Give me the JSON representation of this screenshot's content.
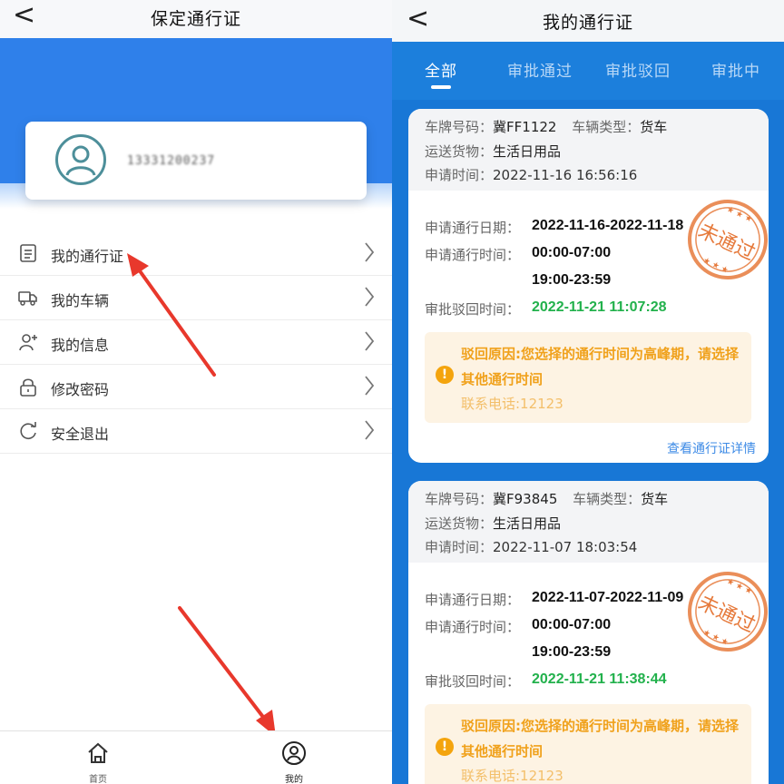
{
  "left": {
    "title": "保定通行证",
    "back_glyph": "<",
    "phone_masked": "13331200237",
    "menu": [
      {
        "label": "我的通行证",
        "icon": "document-list-icon"
      },
      {
        "label": "我的车辆",
        "icon": "truck-icon"
      },
      {
        "label": "我的信息",
        "icon": "user-plus-icon"
      },
      {
        "label": "修改密码",
        "icon": "lock-icon"
      },
      {
        "label": "安全退出",
        "icon": "refresh-icon"
      }
    ],
    "tabbar": [
      {
        "label": "首页",
        "icon": "home-icon"
      },
      {
        "label": "我的",
        "icon": "user-circle-icon"
      }
    ]
  },
  "right": {
    "title": "我的通行证",
    "back_glyph": "<",
    "tabs": [
      {
        "label": "全部",
        "active": true
      },
      {
        "label": "审批通过",
        "active": false
      },
      {
        "label": "审批驳回",
        "active": false
      },
      {
        "label": "审批中",
        "active": false
      }
    ],
    "labels": {
      "plate": "车牌号码：",
      "vehicle_type": "车辆类型：",
      "cargo": "运送货物：",
      "apply_time": "申请时间：",
      "pass_date": "申请通行日期：",
      "pass_time": "申请通行时间：",
      "reject_time": "审批驳回时间：",
      "view_detail": "查看通行证详情",
      "stamp_text": "未通过"
    },
    "cards": [
      {
        "plate": "冀FF1122",
        "vehicle_type": "货车",
        "cargo": "生活日用品",
        "apply_time": "2022-11-16 16:56:16",
        "pass_date": "2022-11-16-2022-11-18",
        "pass_time_1": "00:00-07:00",
        "pass_time_2": "19:00-23:59",
        "reject_time": "2022-11-21 11:07:28",
        "reason": "驳回原因:您选择的通行时间为高峰期，请选择其他通行时间",
        "contact": "联系电话:12123"
      },
      {
        "plate": "冀F93845",
        "vehicle_type": "货车",
        "cargo": "生活日用品",
        "apply_time": "2022-11-07 18:03:54",
        "pass_date": "2022-11-07-2022-11-09",
        "pass_time_1": "00:00-07:00",
        "pass_time_2": "19:00-23:59",
        "reject_time": "2022-11-21 11:38:44",
        "reason": "驳回原因:您选择的通行时间为高峰期，请选择其他通行时间",
        "contact": "联系电话:12123"
      }
    ]
  },
  "colors": {
    "brand_blue": "#2f80ea",
    "right_bg": "#1877d6",
    "reject_green": "#22b14c",
    "warn_orange": "#f0a11b",
    "stamp_orange": "#e67a3c",
    "annotation_red": "#e8382c"
  }
}
